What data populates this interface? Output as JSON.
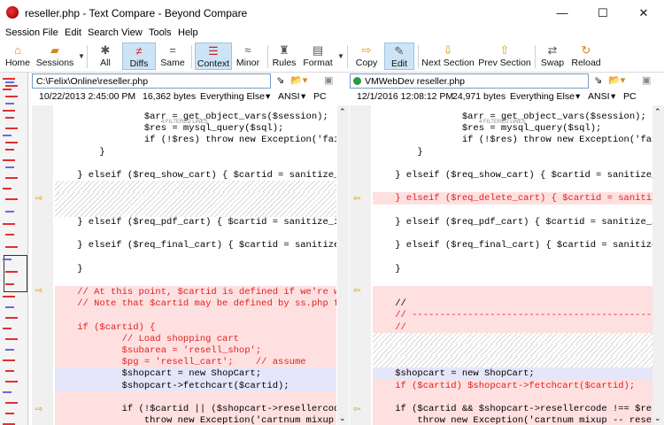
{
  "window": {
    "title": "reseller.php - Text Compare - Beyond Compare",
    "minimize": "—",
    "maximize": "☐",
    "close": "✕"
  },
  "menu": [
    "Session",
    "File",
    "Edit",
    "Search",
    "View",
    "Tools",
    "Help"
  ],
  "toolbar": {
    "home": "Home",
    "sessions": "Sessions",
    "all": "All",
    "diffs": "Diffs",
    "same": "Same",
    "context": "Context",
    "minor": "Minor",
    "rules": "Rules",
    "format": "Format",
    "copy": "Copy",
    "edit": "Edit",
    "next_section": "Next Section",
    "prev_section": "Prev Section",
    "swap": "Swap",
    "reload": "Reload"
  },
  "left": {
    "path": "C:\\Felix\\Online\\reseller.php",
    "date": "10/22/2013 2:45:00 PM",
    "size": "16,362 bytes",
    "filter": "Everything Else",
    "encoding": "ANSI",
    "lineend": "PC"
  },
  "right": {
    "path": "VMWebDev  reseller.php",
    "date": "12/1/2016 12:08:12 PM",
    "size": "24,971 bytes",
    "filter": "Everything Else",
    "encoding": "ANSI",
    "lineend": "PC"
  },
  "filtered_label": "4 FILTERED LINES",
  "left_lines": [
    "                $arr = get_object_vars($session);",
    "                $res = mysql_query($sql);",
    "                if (!$res) throw new Exception('fai",
    "        }",
    "",
    "    } elseif ($req_show_cart) { $cartid = sanitize_int(",
    "",
    "",
    "",
    "    } elseif ($req_pdf_cart) { $cartid = sanitize_int($",
    "",
    "    } elseif ($req_final_cart) { $cartid = sanitize_int",
    "",
    "    }",
    "",
    "    // At this point, $cartid is defined if we're worki",
    "    // Note that $cartid may be defined by ss.php from",
    "",
    "    if ($cartid) {",
    "            // Load shopping cart",
    "            $subarea = 'resell_shop';",
    "            $pg = 'resell_cart';    // assume",
    "            $shopcart = new ShopCart;",
    "            $shopcart->fetchcart($cartid);",
    "",
    "            if (!$cartid || ($shopcart->resellercode !=",
    "                throw new Exception('cartnum mixup"
  ],
  "right_lines": [
    "                $arr = get_object_vars($session);",
    "                $res = mysql_query($sql);",
    "                if (!$res) throw new Exception('fai",
    "        }",
    "",
    "    } elseif ($req_show_cart) { $cartid = sanitize_int",
    "",
    "    } elseif ($req_delete_cart) { $cartid = sanitize_in",
    "",
    "    } elseif ($req_pdf_cart) { $cartid = sanitize_int($",
    "",
    "    } elseif ($req_final_cart) { $cartid = sanitize_int",
    "",
    "    }",
    "",
    "",
    "    //",
    "    // -----------------------------------------------",
    "    //",
    "",
    "",
    "",
    "    $shopcart = new ShopCart;",
    "    if ($cartid) $shopcart->fetchcart($cartid);",
    "",
    "    if ($cartid && $shopcart->resellercode !== $resell",
    "        throw new Exception('cartnum mixup -- resel"
  ],
  "colors": {
    "diff_red": "#e02020",
    "diff_bg": "#ffe0e0",
    "accent": "#2a6fc9"
  }
}
